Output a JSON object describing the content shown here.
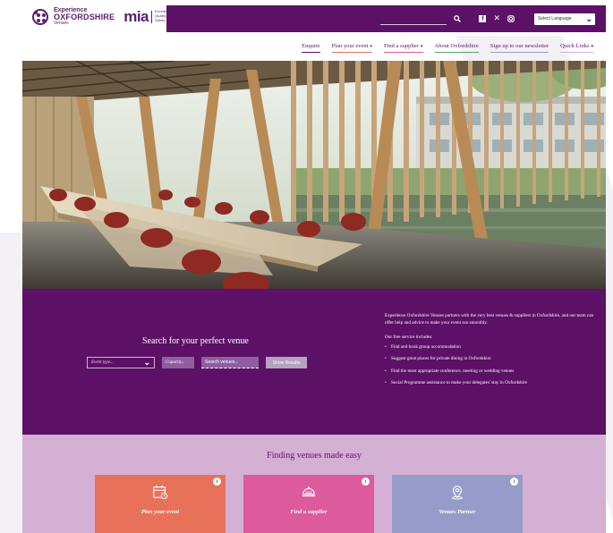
{
  "header": {
    "logo_line1": "Experience",
    "logo_line2": "OXFORDSHIRE",
    "logo_line3": "Venues",
    "mia_word": "mia",
    "mia_tagline": "Excellence Quality Safety",
    "language_select": "Select Language"
  },
  "nav": [
    {
      "label": "Enquire",
      "color": "#5c1066",
      "has_caret": false
    },
    {
      "label": "Plan your event",
      "color": "#e8715a",
      "has_caret": true
    },
    {
      "label": "Find a supplier",
      "color": "#dd5a9c",
      "has_caret": true
    },
    {
      "label": "About Oxfordshire",
      "color": "#5aa06a",
      "has_caret": false
    },
    {
      "label": "Sign up to our newsletter",
      "color": "#979bc9",
      "has_caret": false
    },
    {
      "label": "Quick Links",
      "color": "#d4b0d4",
      "has_caret": true
    }
  ],
  "search": {
    "title": "Search for your perfect venue",
    "event_type_placeholder": "Event type...",
    "capacity_placeholder": "Capacity...",
    "venue_placeholder": "Search venues...",
    "button": "Show Results"
  },
  "info": {
    "intro": "Experience Oxfordshire Venues partners with the very best venues & suppliers in Oxfordshire, and our team can offer help and advice to make your event run smoothly.",
    "subhead": "Our free service includes:",
    "items": [
      "Find and book group accommodation",
      "Suggest great places for private dining in Oxfordshire",
      "Find the most appropriate conference, meeting or wedding venues",
      "Social Programme assistance to make your delegates' stay in Oxfordshire"
    ]
  },
  "finding": {
    "title": "Finding venues made easy",
    "cards": [
      {
        "label": "Plan your event",
        "icon": "calendar-icon",
        "color": "#e8715a"
      },
      {
        "label": "Find a supplier",
        "icon": "food-tray-icon",
        "color": "#dd5a9c"
      },
      {
        "label": "Venues Partner",
        "icon": "location-pin-icon",
        "color": "#979bc9"
      }
    ]
  }
}
